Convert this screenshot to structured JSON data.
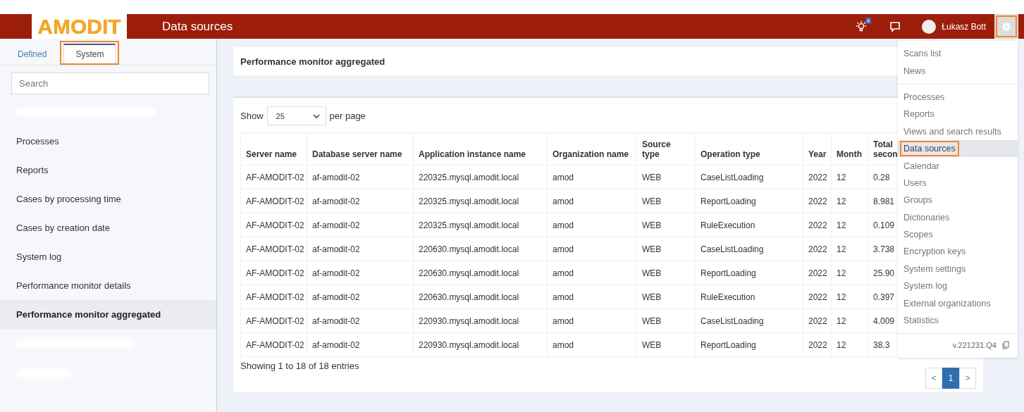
{
  "header": {
    "logo": "AMODIT",
    "title": "Data sources",
    "notifications_badge": "4",
    "user_name": "Łukasz Bott",
    "settings_highlighted": true
  },
  "sidebar": {
    "tabs": [
      {
        "label": "Defined",
        "selected": false,
        "highlighted": false
      },
      {
        "label": "System",
        "selected": true,
        "highlighted": true
      }
    ],
    "search": {
      "placeholder": "Search"
    },
    "items": [
      {
        "kind": "redacted"
      },
      {
        "kind": "item",
        "label": "Processes",
        "selected": false
      },
      {
        "kind": "item",
        "label": "Reports",
        "selected": false
      },
      {
        "kind": "item",
        "label": "Cases by processing time",
        "selected": false
      },
      {
        "kind": "item",
        "label": "Cases by creation date",
        "selected": false
      },
      {
        "kind": "item",
        "label": "System log",
        "selected": false
      },
      {
        "kind": "item",
        "label": "Performance monitor details",
        "selected": false
      },
      {
        "kind": "item",
        "label": "Performance monitor aggregated",
        "selected": true
      },
      {
        "kind": "redacted"
      },
      {
        "kind": "redacted"
      }
    ]
  },
  "page_title": "Performance monitor aggregated",
  "page_size": {
    "label_before": "Show",
    "value": "25",
    "label_after": "per page"
  },
  "table": {
    "columns": [
      "Server name",
      "Database server name",
      "Application instance name",
      "Organization name",
      "Source type",
      "Operation type",
      "Year",
      "Month",
      "Total secon"
    ],
    "rows": [
      [
        "AF-AMODIT-02",
        "af-amodit-02",
        "220325.mysql.amodit.local",
        "amod",
        "WEB",
        "CaseListLoading",
        "2022",
        "12",
        "0.28"
      ],
      [
        "AF-AMODIT-02",
        "af-amodit-02",
        "220325.mysql.amodit.local",
        "amod",
        "WEB",
        "ReportLoading",
        "2022",
        "12",
        "8.981"
      ],
      [
        "AF-AMODIT-02",
        "af-amodit-02",
        "220325.mysql.amodit.local",
        "amod",
        "WEB",
        "RuleExecution",
        "2022",
        "12",
        "0.109"
      ],
      [
        "AF-AMODIT-02",
        "af-amodit-02",
        "220630.mysql.amodit.local",
        "amod",
        "WEB",
        "CaseListLoading",
        "2022",
        "12",
        "3.738"
      ],
      [
        "AF-AMODIT-02",
        "af-amodit-02",
        "220630.mysql.amodit.local",
        "amod",
        "WEB",
        "ReportLoading",
        "2022",
        "12",
        "25.90"
      ],
      [
        "AF-AMODIT-02",
        "af-amodit-02",
        "220630.mysql.amodit.local",
        "amod",
        "WEB",
        "RuleExecution",
        "2022",
        "12",
        "0.397"
      ],
      [
        "AF-AMODIT-02",
        "af-amodit-02",
        "220930.mysql.amodit.local",
        "amod",
        "WEB",
        "CaseListLoading",
        "2022",
        "12",
        "4.009"
      ],
      [
        "AF-AMODIT-02",
        "af-amodit-02",
        "220930.mysql.amodit.local",
        "amod",
        "WEB",
        "ReportLoading",
        "2022",
        "12",
        "38.3"
      ]
    ]
  },
  "footer_info": "Showing 1 to 18 of 18 entries",
  "pagination": [
    {
      "label": "<",
      "selected": false
    },
    {
      "label": "1",
      "selected": true
    },
    {
      "label": ">",
      "selected": false
    }
  ],
  "settings_menu": {
    "groups": [
      [
        {
          "label": "Scans list",
          "selected": false,
          "highlighted": false
        },
        {
          "label": "News",
          "selected": false,
          "highlighted": false
        }
      ],
      [
        {
          "label": "Processes",
          "selected": false,
          "highlighted": false
        },
        {
          "label": "Reports",
          "selected": false,
          "highlighted": false
        },
        {
          "label": "Views and search results",
          "selected": false,
          "highlighted": false
        },
        {
          "label": "Data sources",
          "selected": true,
          "highlighted": true
        },
        {
          "label": "Calendar",
          "selected": false,
          "highlighted": false
        },
        {
          "label": "Users",
          "selected": false,
          "highlighted": false
        },
        {
          "label": "Groups",
          "selected": false,
          "highlighted": false
        },
        {
          "label": "Dictionaries",
          "selected": false,
          "highlighted": false
        },
        {
          "label": "Scopes",
          "selected": false,
          "highlighted": false
        },
        {
          "label": "Encryption keys",
          "selected": false,
          "highlighted": false
        },
        {
          "label": "System settings",
          "selected": false,
          "highlighted": false
        },
        {
          "label": "System log",
          "selected": false,
          "highlighted": false
        },
        {
          "label": "External organizations",
          "selected": false,
          "highlighted": false
        },
        {
          "label": "Statistics",
          "selected": false,
          "highlighted": false
        }
      ]
    ],
    "version": "v.221231.Q4"
  }
}
